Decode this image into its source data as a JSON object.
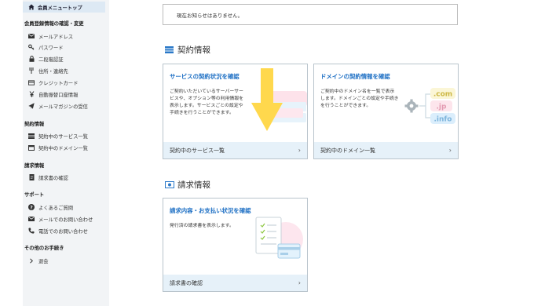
{
  "sidebar": {
    "top_item": "会員メニュートップ",
    "sections": [
      {
        "title": "会員登録情報の確認・変更",
        "items": [
          {
            "label": "メールアドレス",
            "icon": "mail-icon"
          },
          {
            "label": "パスワード",
            "icon": "key-icon"
          },
          {
            "label": "二段階認証",
            "icon": "lock-icon"
          },
          {
            "label": "住所・連絡先",
            "icon": "postal-icon"
          },
          {
            "label": "クレジットカード",
            "icon": "credit-card-icon"
          },
          {
            "label": "自動振替口座情報",
            "icon": "yen-icon"
          },
          {
            "label": "メールマガジンの受信",
            "icon": "paper-plane-icon"
          }
        ]
      },
      {
        "title": "契約情報",
        "items": [
          {
            "label": "契約中のサービス一覧",
            "icon": "server-icon"
          },
          {
            "label": "契約中のドメイン一覧",
            "icon": "window-icon"
          }
        ]
      },
      {
        "title": "請求情報",
        "items": [
          {
            "label": "請求書の確認",
            "icon": "document-icon"
          }
        ]
      },
      {
        "title": "サポート",
        "items": [
          {
            "label": "よくあるご質問",
            "icon": "question-icon"
          },
          {
            "label": "メールでのお問い合わせ",
            "icon": "mail-icon"
          },
          {
            "label": "電話でのお問い合わせ",
            "icon": "phone-icon"
          }
        ]
      },
      {
        "title": "その他のお手続き",
        "items": [
          {
            "label": "退会",
            "icon": "chevron-right-icon"
          }
        ]
      }
    ]
  },
  "notice": {
    "text": "現在お知らせはありません。"
  },
  "contract": {
    "heading": "契約情報",
    "cards": [
      {
        "title": "サービスの契約状況を確認",
        "desc": "ご契約いただいているサーバーサービスや、オプション等の利用情報を表示します。サービスごとの設定や手続きを行うことができます。",
        "footer": "契約中のサービス一覧"
      },
      {
        "title": "ドメインの契約情報を確認",
        "desc": "ご契約中のドメイン名を一覧で表示します。ドメインごとの設定や手続きを行うことができます。",
        "footer": "契約中のドメイン一覧",
        "tlds": [
          ".com",
          ".jp",
          ".info"
        ]
      }
    ]
  },
  "billing": {
    "heading": "請求情報",
    "card": {
      "title": "請求内容・お支払い状況を確認",
      "desc": "発行済の請求書を表示します。",
      "footer": "請求書の確認"
    }
  },
  "colors": {
    "accent": "#1d6fc4",
    "arrow": "#ffd84d",
    "footer_bg": "#e6f1f9",
    "sidebar_bg": "#f2f4f6"
  }
}
